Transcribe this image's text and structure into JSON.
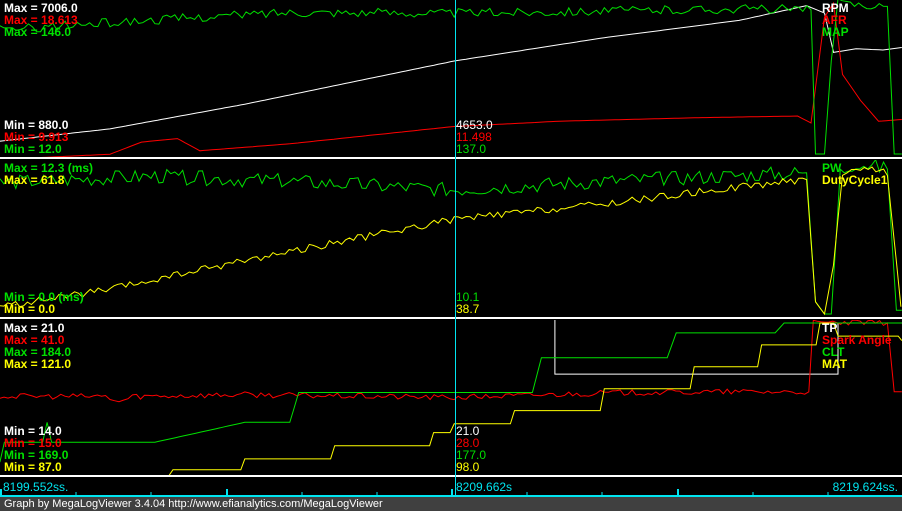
{
  "colors": {
    "white": "#ffffff",
    "red": "#ff0000",
    "green": "#00e000",
    "yellow": "#ffff00",
    "cyan": "#00e5f0",
    "footer_bg": "#404040"
  },
  "time_axis": {
    "start": 8199.552,
    "end": 8219.624,
    "cursor": 8209.662,
    "start_label": "8199.552ss.",
    "cursor_label": "8209.662s",
    "end_label": "8219.624ss."
  },
  "footer": "Graph by MegaLogViewer 3.4.04 http://www.efianalytics.com/MegaLogViewer",
  "panels": [
    {
      "traces": [
        {
          "name": "RPM",
          "color": "#ffffff",
          "max_label": "Max = 7006.0",
          "min_label": "Min = 880.0",
          "cursor_value": "4653.0",
          "min": 880,
          "max": 7006,
          "points": [
            [
              8199.55,
              1400
            ],
            [
              8202,
              1900
            ],
            [
              8205,
              2900
            ],
            [
              8209.66,
              4653
            ],
            [
              8213,
              5600
            ],
            [
              8216,
              6300
            ],
            [
              8217.5,
              6900
            ],
            [
              8217.9,
              6600
            ],
            [
              8218.1,
              5000
            ],
            [
              8218.6,
              5150
            ],
            [
              8219.2,
              5100
            ],
            [
              8219.62,
              5200
            ]
          ]
        },
        {
          "name": "AFR",
          "color": "#ff0000",
          "max_label": "Max = 18.613",
          "min_label": "Min = 9.913",
          "cursor_value": "11.498",
          "min": 9.913,
          "max": 18.613,
          "points": [
            [
              8199.55,
              9.6
            ],
            [
              8202,
              9.9
            ],
            [
              8202.7,
              10.6
            ],
            [
              8203.5,
              10.8
            ],
            [
              8204,
              10.1
            ],
            [
              8206,
              10.5
            ],
            [
              8209.66,
              11.5
            ],
            [
              8212,
              11.8
            ],
            [
              8215,
              12.0
            ],
            [
              8217.3,
              12.1
            ],
            [
              8217.6,
              11.7
            ],
            [
              8217.9,
              17.8
            ],
            [
              8218.1,
              18.6
            ],
            [
              8218.3,
              14.5
            ],
            [
              8218.7,
              13.0
            ],
            [
              8219.1,
              11.8
            ],
            [
              8219.62,
              11.9
            ]
          ]
        },
        {
          "name": "MAP",
          "color": "#00e000",
          "max_label": "Max = 146.0",
          "min_label": "Min = 12.0",
          "cursor_value": "137.0",
          "min": 12,
          "max": 146,
          "points": [
            [
              8199.55,
              122
            ],
            [
              8201,
              126
            ],
            [
              8203,
              131
            ],
            [
              8206,
              138
            ],
            [
              8209.66,
              137
            ],
            [
              8213,
              139
            ],
            [
              8216.5,
              141
            ],
            [
              8217.6,
              140
            ],
            [
              8217.7,
              12
            ],
            [
              8217.9,
              12
            ],
            [
              8218.05,
              95
            ],
            [
              8218.2,
              146
            ],
            [
              8219.3,
              143
            ],
            [
              8219.45,
              12
            ],
            [
              8219.62,
              12
            ]
          ],
          "noise": 8
        }
      ]
    },
    {
      "traces": [
        {
          "name": "PW",
          "color": "#00e000",
          "max_label": "Max = 12.3 (ms)",
          "min_label": "Min = 0.0 (ms)",
          "cursor_value": "10.1",
          "min": 0,
          "max": 12.3,
          "points": [
            [
              8199.55,
              10.7
            ],
            [
              8203,
              11.2
            ],
            [
              8206,
              10.8
            ],
            [
              8209.66,
              10.1
            ],
            [
              8213,
              10.8
            ],
            [
              8217.5,
              11.5
            ],
            [
              8217.7,
              1.0
            ],
            [
              8217.9,
              0
            ],
            [
              8218.05,
              0
            ],
            [
              8218.25,
              11.5
            ],
            [
              8218.6,
              12.3
            ],
            [
              8219.3,
              11.8
            ],
            [
              8219.5,
              0.3
            ],
            [
              8219.62,
              0.3
            ]
          ],
          "noise": 1.2
        },
        {
          "name": "DutyCycle1",
          "color": "#ffff00",
          "max_label": "Max = 61.8",
          "min_label": "Min = 0.0",
          "cursor_value": "38.7",
          "min": 0,
          "max": 61.8,
          "points": [
            [
              8199.55,
              3
            ],
            [
              8202,
              10
            ],
            [
              8205,
              22
            ],
            [
              8209.66,
              38.7
            ],
            [
              8213,
              45
            ],
            [
              8216,
              52
            ],
            [
              8217.5,
              55
            ],
            [
              8217.7,
              5
            ],
            [
              8217.9,
              0
            ],
            [
              8218.1,
              20
            ],
            [
              8218.3,
              58
            ],
            [
              8218.7,
              60
            ],
            [
              8219.3,
              58
            ],
            [
              8219.6,
              3
            ]
          ],
          "noise": 3
        }
      ]
    },
    {
      "traces": [
        {
          "name": "TP",
          "color": "#ffffff",
          "max_label": "Max = 21.0",
          "min_label": "Min = 14.0",
          "cursor_value": "21.0",
          "min": 14,
          "max": 21,
          "points": [
            [
              8211.9,
              23
            ],
            [
              8211.9,
              18.6
            ],
            [
              8218.2,
              18.6
            ],
            [
              8218.2,
              21
            ],
            [
              8219.62,
              21
            ]
          ]
        },
        {
          "name": "Spark Angle",
          "color": "#ff0000",
          "max_label": "Max = 41.0",
          "min_label": "Min = 15.0",
          "cursor_value": "28.0",
          "min": 15,
          "max": 41,
          "points": [
            [
              8199.55,
              28.2
            ],
            [
              8201.9,
              28.2
            ],
            [
              8202.2,
              27.2
            ],
            [
              8202.5,
              28.2
            ],
            [
              8205,
              28.5
            ],
            [
              8209.66,
              28
            ],
            [
              8213,
              28.8
            ],
            [
              8216,
              29
            ],
            [
              8217.55,
              29
            ],
            [
              8217.65,
              41
            ],
            [
              8219.3,
              41
            ],
            [
              8219.45,
              29
            ],
            [
              8219.62,
              29
            ]
          ],
          "noise": 1
        },
        {
          "name": "CLT",
          "color": "#00e000",
          "max_label": "Max = 184.0",
          "min_label": "Min = 169.0",
          "cursor_value": "177.0",
          "min": 169,
          "max": 184,
          "points": [
            [
              8199.55,
              170
            ],
            [
              8199.65,
              172
            ],
            [
              8200.5,
              172
            ],
            [
              8200.6,
              174
            ],
            [
              8200.7,
              172
            ],
            [
              8203,
              172
            ],
            [
              8205,
              174
            ],
            [
              8206.0,
              174
            ],
            [
              8206.2,
              177
            ],
            [
              8211.4,
              177
            ],
            [
              8211.6,
              180.5
            ],
            [
              8214.4,
              180.5
            ],
            [
              8214.6,
              183
            ],
            [
              8216.8,
              183
            ],
            [
              8217.0,
              184
            ],
            [
              8219.62,
              184
            ]
          ],
          "noise": 0
        },
        {
          "name": "MAT",
          "color": "#ffff00",
          "max_label": "Max = 121.0",
          "min_label": "Min = 87.0",
          "cursor_value": "98.0",
          "min": 87,
          "max": 121,
          "points": [
            [
              8199.55,
              85
            ],
            [
              8201.5,
              85
            ],
            [
              8201.6,
              86
            ],
            [
              8203.3,
              86
            ],
            [
              8203.4,
              87.5
            ],
            [
              8205,
              90
            ],
            [
              8207,
              93
            ],
            [
              8209.2,
              96
            ],
            [
              8209.66,
              98
            ],
            [
              8211,
              101
            ],
            [
              8213,
              106
            ],
            [
              8215,
              111
            ],
            [
              8216.5,
              116
            ],
            [
              8217.8,
              121
            ],
            [
              8218,
              121
            ],
            [
              8218.2,
              118
            ],
            [
              8219.3,
              118
            ],
            [
              8219.62,
              117
            ]
          ],
          "noise": 0,
          "steps": true
        }
      ]
    }
  ]
}
